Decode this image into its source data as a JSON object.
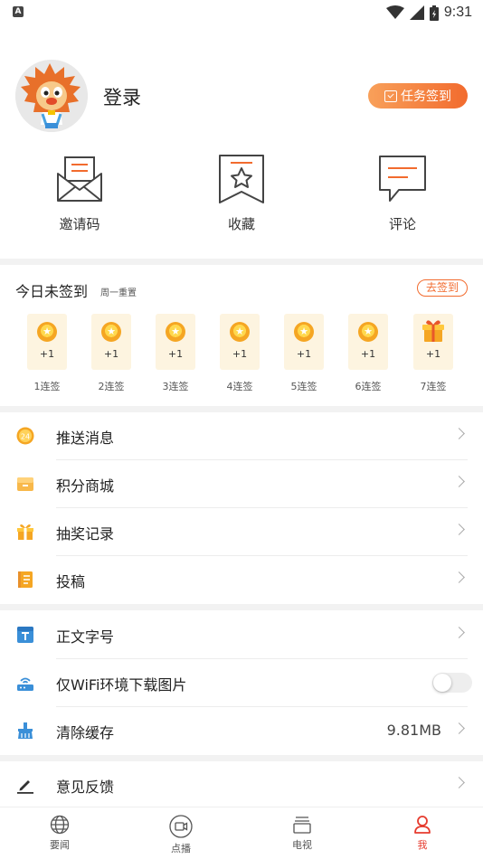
{
  "status_bar": {
    "time": "9:31",
    "left_icon": "A"
  },
  "profile": {
    "login_label": "登录",
    "task_button": "任务签到"
  },
  "quick_actions": [
    {
      "label": "邀请码",
      "icon": "envelope-icon"
    },
    {
      "label": "收藏",
      "icon": "bookmark-star-icon"
    },
    {
      "label": "评论",
      "icon": "comment-icon"
    }
  ],
  "signin": {
    "title": "今日未签到",
    "subtitle": "周一重置",
    "button": "去签到",
    "days": [
      {
        "reward": "+1",
        "label": "1连签",
        "icon": "coin-icon"
      },
      {
        "reward": "+1",
        "label": "2连签",
        "icon": "coin-icon"
      },
      {
        "reward": "+1",
        "label": "3连签",
        "icon": "coin-icon"
      },
      {
        "reward": "+1",
        "label": "4连签",
        "icon": "coin-icon"
      },
      {
        "reward": "+1",
        "label": "5连签",
        "icon": "coin-icon"
      },
      {
        "reward": "+1",
        "label": "6连签",
        "icon": "coin-icon"
      },
      {
        "reward": "+1",
        "label": "7连签",
        "icon": "gift-icon"
      }
    ]
  },
  "menu_group1": [
    {
      "label": "推送消息",
      "icon": "push-message-icon"
    },
    {
      "label": "积分商城",
      "icon": "store-icon"
    },
    {
      "label": "抽奖记录",
      "icon": "gift-box-icon"
    },
    {
      "label": "投稿",
      "icon": "document-icon"
    }
  ],
  "menu_group2": [
    {
      "label": "正文字号",
      "icon": "font-size-icon"
    },
    {
      "label": "仅WiFi环境下载图片",
      "icon": "wifi-router-icon",
      "toggle": false
    },
    {
      "label": "清除缓存",
      "icon": "broom-icon",
      "value": "9.81MB"
    }
  ],
  "menu_group3": [
    {
      "label": "意见反馈",
      "icon": "pencil-icon"
    }
  ],
  "bottom_nav": [
    {
      "label": "要闻",
      "icon": "globe-icon"
    },
    {
      "label": "点播",
      "icon": "video-icon"
    },
    {
      "label": "电视",
      "icon": "tv-icon"
    },
    {
      "label": "我",
      "icon": "person-icon",
      "active": true
    }
  ],
  "colors": {
    "accent": "#f26b2e",
    "nav_active": "#e63b2e",
    "icon_gray": "#555555",
    "coin": "#f5a623"
  }
}
